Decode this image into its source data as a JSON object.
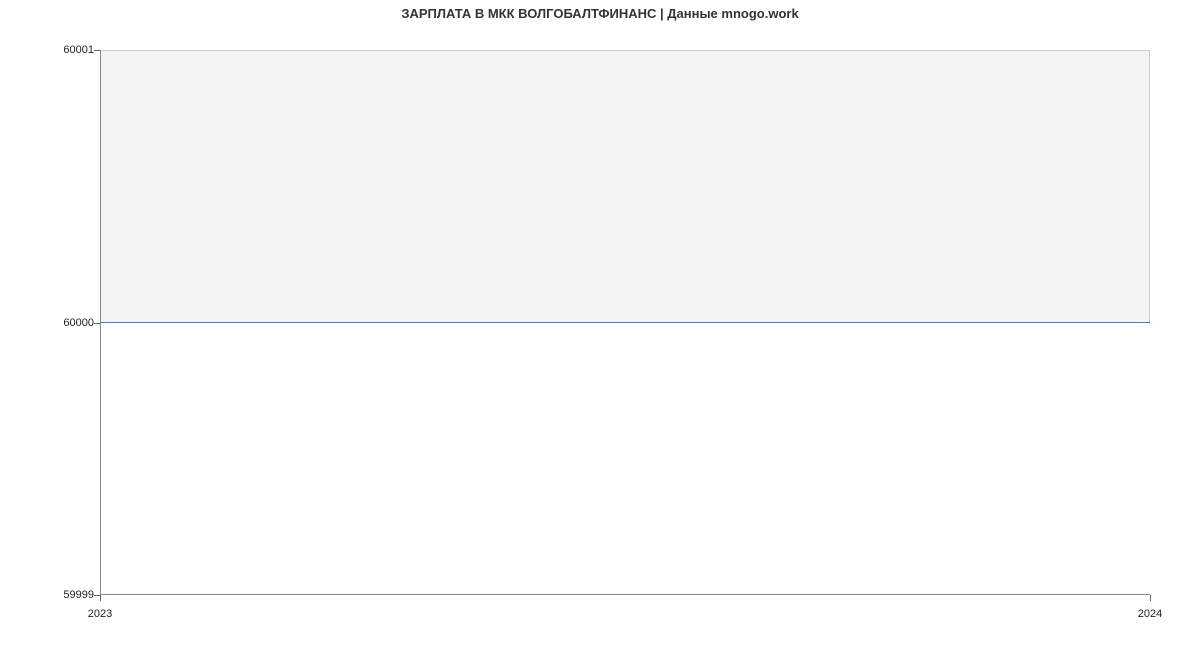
{
  "chart_data": {
    "type": "line",
    "title": "ЗАРПЛАТА В МКК ВОЛГОБАЛТФИНАНС | Данные mnogo.work",
    "xlabel": "",
    "ylabel": "",
    "x_ticks": [
      "2023",
      "2024"
    ],
    "y_ticks": [
      "59999",
      "60000",
      "60001"
    ],
    "xlim": [
      2023,
      2024
    ],
    "ylim": [
      59999,
      60001
    ],
    "x": [
      2023,
      2024
    ],
    "values": [
      60000,
      60000
    ],
    "line_color": "#4a7bd1"
  }
}
